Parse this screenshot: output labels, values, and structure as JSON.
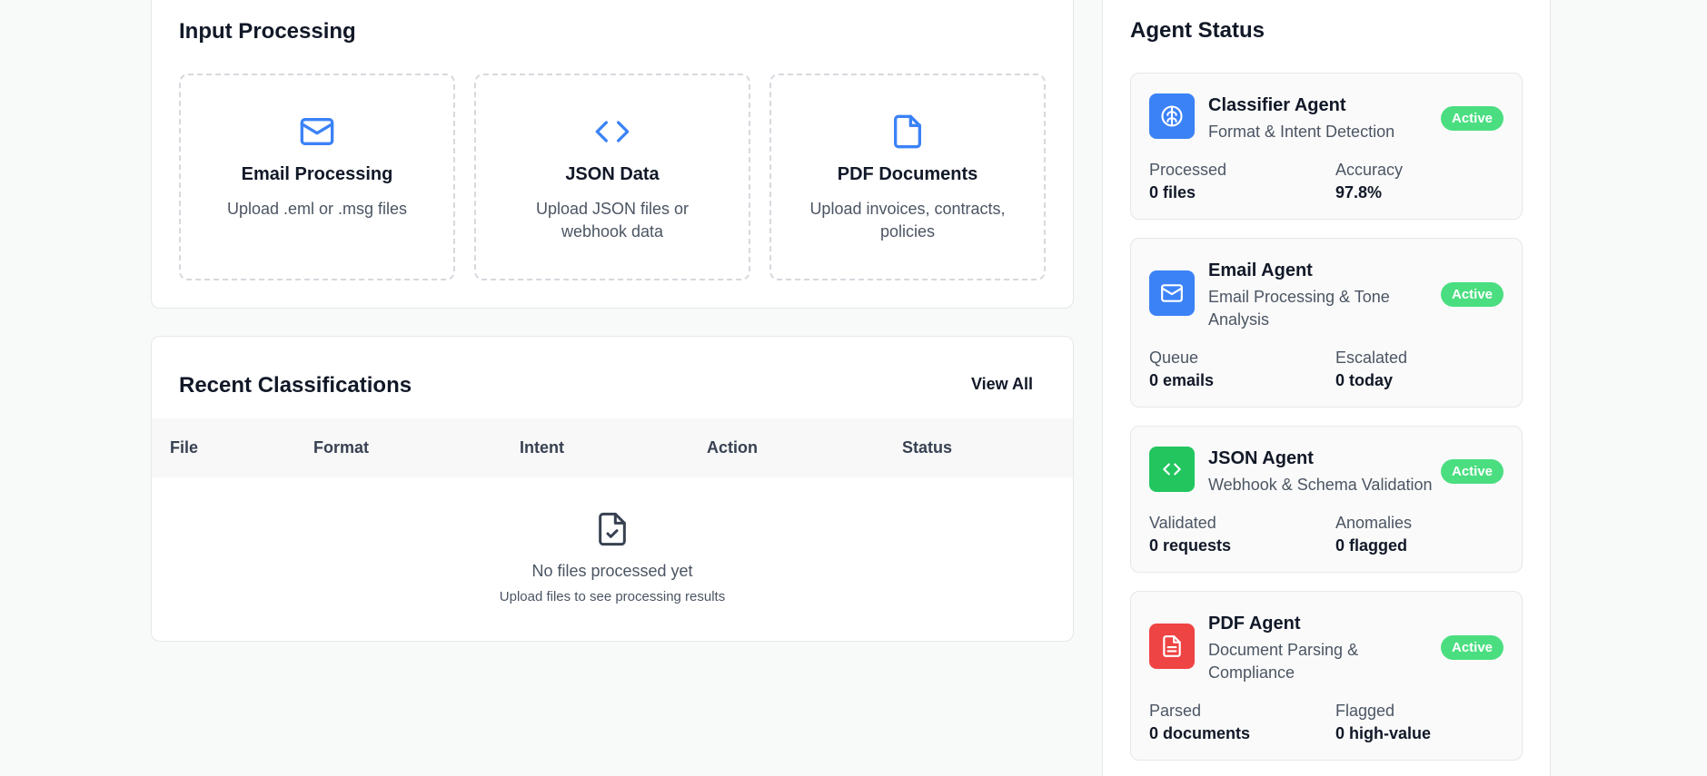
{
  "input_processing": {
    "title": "Input Processing",
    "options": [
      {
        "icon": "mail-icon",
        "title": "Email Processing",
        "description": "Upload .eml or .msg files"
      },
      {
        "icon": "code-icon",
        "title": "JSON Data",
        "description": "Upload JSON files or webhook data"
      },
      {
        "icon": "file-icon",
        "title": "PDF Documents",
        "description": "Upload invoices, contracts, policies"
      }
    ]
  },
  "recent_classifications": {
    "title": "Recent Classifications",
    "view_all_label": "View All",
    "columns": [
      "File",
      "Format",
      "Intent",
      "Action",
      "Status"
    ],
    "empty_state": {
      "icon": "file-check-icon",
      "title": "No files processed yet",
      "subtitle": "Upload files to see processing results"
    }
  },
  "agent_status": {
    "title": "Agent Status",
    "agents": [
      {
        "name": "Classifier Agent",
        "description": "Format & Intent Detection",
        "status": "Active",
        "icon": "brain-icon",
        "icon_color": "#3b82f6",
        "stats": [
          {
            "label": "Processed",
            "value": "0 files"
          },
          {
            "label": "Accuracy",
            "value": "97.8%"
          }
        ]
      },
      {
        "name": "Email Agent",
        "description": "Email Processing & Tone Analysis",
        "status": "Active",
        "icon": "mail-icon",
        "icon_color": "#3b82f6",
        "stats": [
          {
            "label": "Queue",
            "value": "0 emails"
          },
          {
            "label": "Escalated",
            "value": "0 today"
          }
        ]
      },
      {
        "name": "JSON Agent",
        "description": "Webhook & Schema Validation",
        "status": "Active",
        "icon": "code-icon",
        "icon_color": "#22c55e",
        "stats": [
          {
            "label": "Validated",
            "value": "0 requests"
          },
          {
            "label": "Anomalies",
            "value": "0 flagged"
          }
        ]
      },
      {
        "name": "PDF Agent",
        "description": "Document Parsing & Compliance",
        "status": "Active",
        "icon": "file-text-icon",
        "icon_color": "#ef4444",
        "stats": [
          {
            "label": "Parsed",
            "value": "0 documents"
          },
          {
            "label": "Flagged",
            "value": "0 high-value"
          }
        ]
      }
    ]
  },
  "colors": {
    "accent_blue": "#3b82f6",
    "success_green": "#22c55e",
    "danger_red": "#ef4444",
    "badge_green": "#4ade80"
  }
}
